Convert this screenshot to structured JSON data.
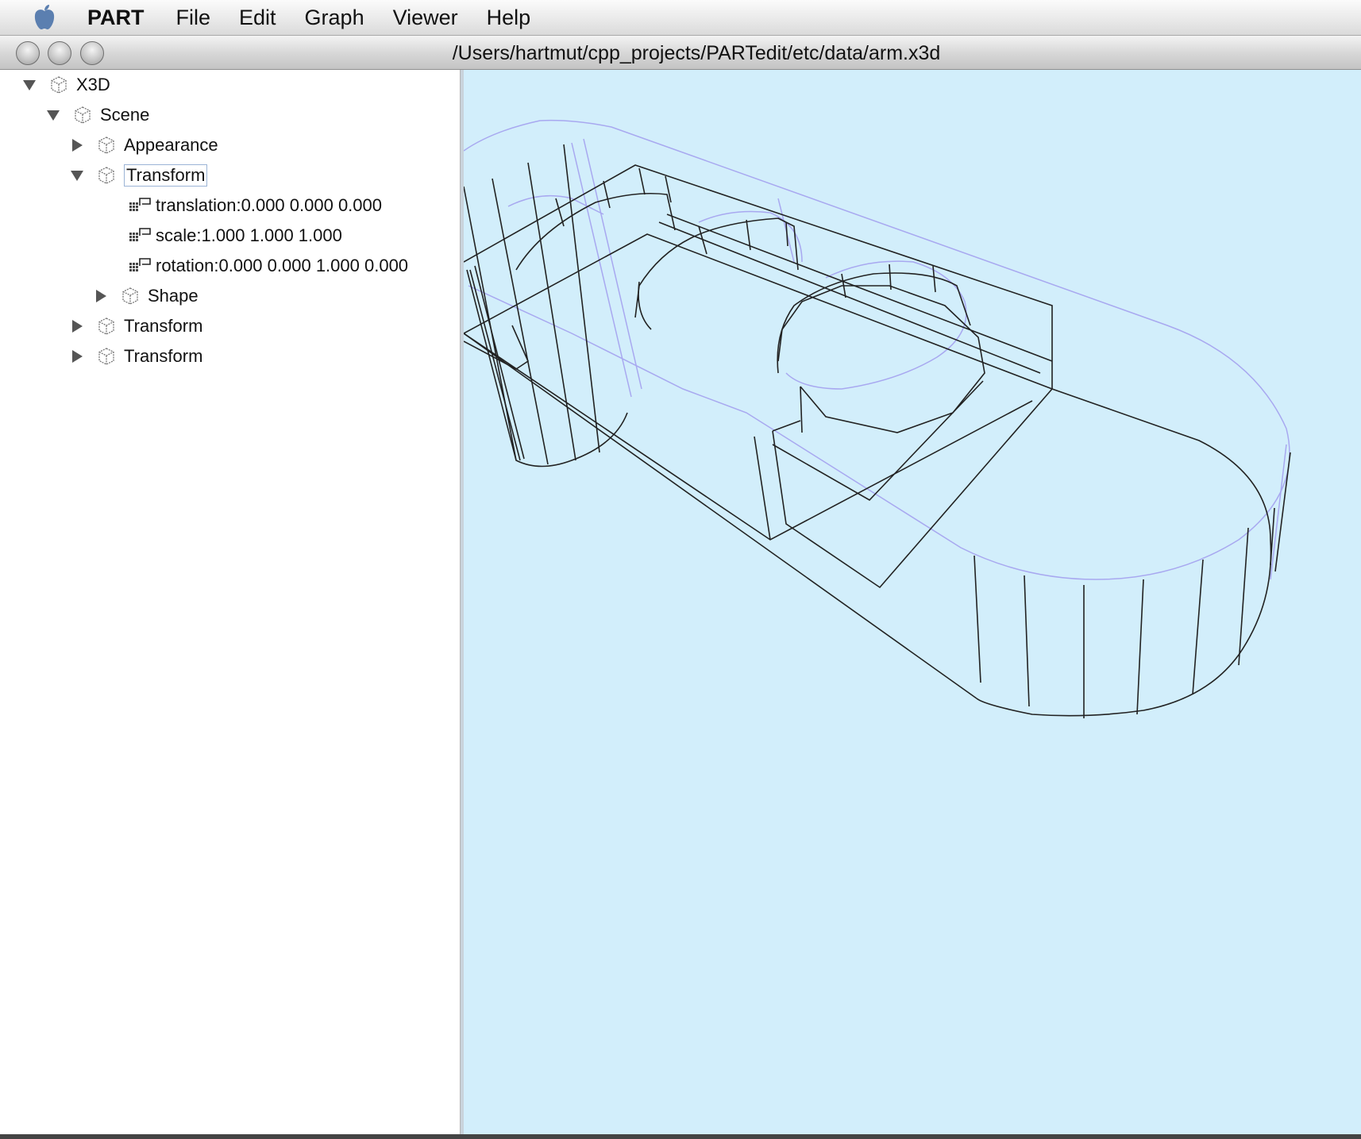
{
  "menubar": {
    "app_name": "PART",
    "items": [
      "File",
      "Edit",
      "Graph",
      "Viewer",
      "Help"
    ]
  },
  "window": {
    "title": "/Users/hartmut/cpp_projects/PARTedit/etc/data/arm.x3d"
  },
  "tree": {
    "nodes": [
      {
        "label": "X3D",
        "kind": "node",
        "state": "expanded"
      },
      {
        "label": "Scene",
        "kind": "node",
        "state": "expanded"
      },
      {
        "label": "Appearance",
        "kind": "node",
        "state": "collapsed"
      },
      {
        "label": "Transform",
        "kind": "node",
        "state": "expanded",
        "selected": true
      },
      {
        "label": "translation:0.000 0.000 0.000",
        "kind": "field"
      },
      {
        "label": "scale:1.000 1.000 1.000",
        "kind": "field"
      },
      {
        "label": "rotation:0.000 0.000 1.000 0.000",
        "kind": "field"
      },
      {
        "label": "Shape",
        "kind": "node",
        "state": "collapsed"
      },
      {
        "label": "Transform",
        "kind": "node",
        "state": "collapsed"
      },
      {
        "label": "Transform",
        "kind": "node",
        "state": "collapsed"
      }
    ]
  },
  "viewer": {
    "background_color": "#d2eefb",
    "wire_color": "#222222",
    "silhouette_color": "#a8a8f0"
  }
}
